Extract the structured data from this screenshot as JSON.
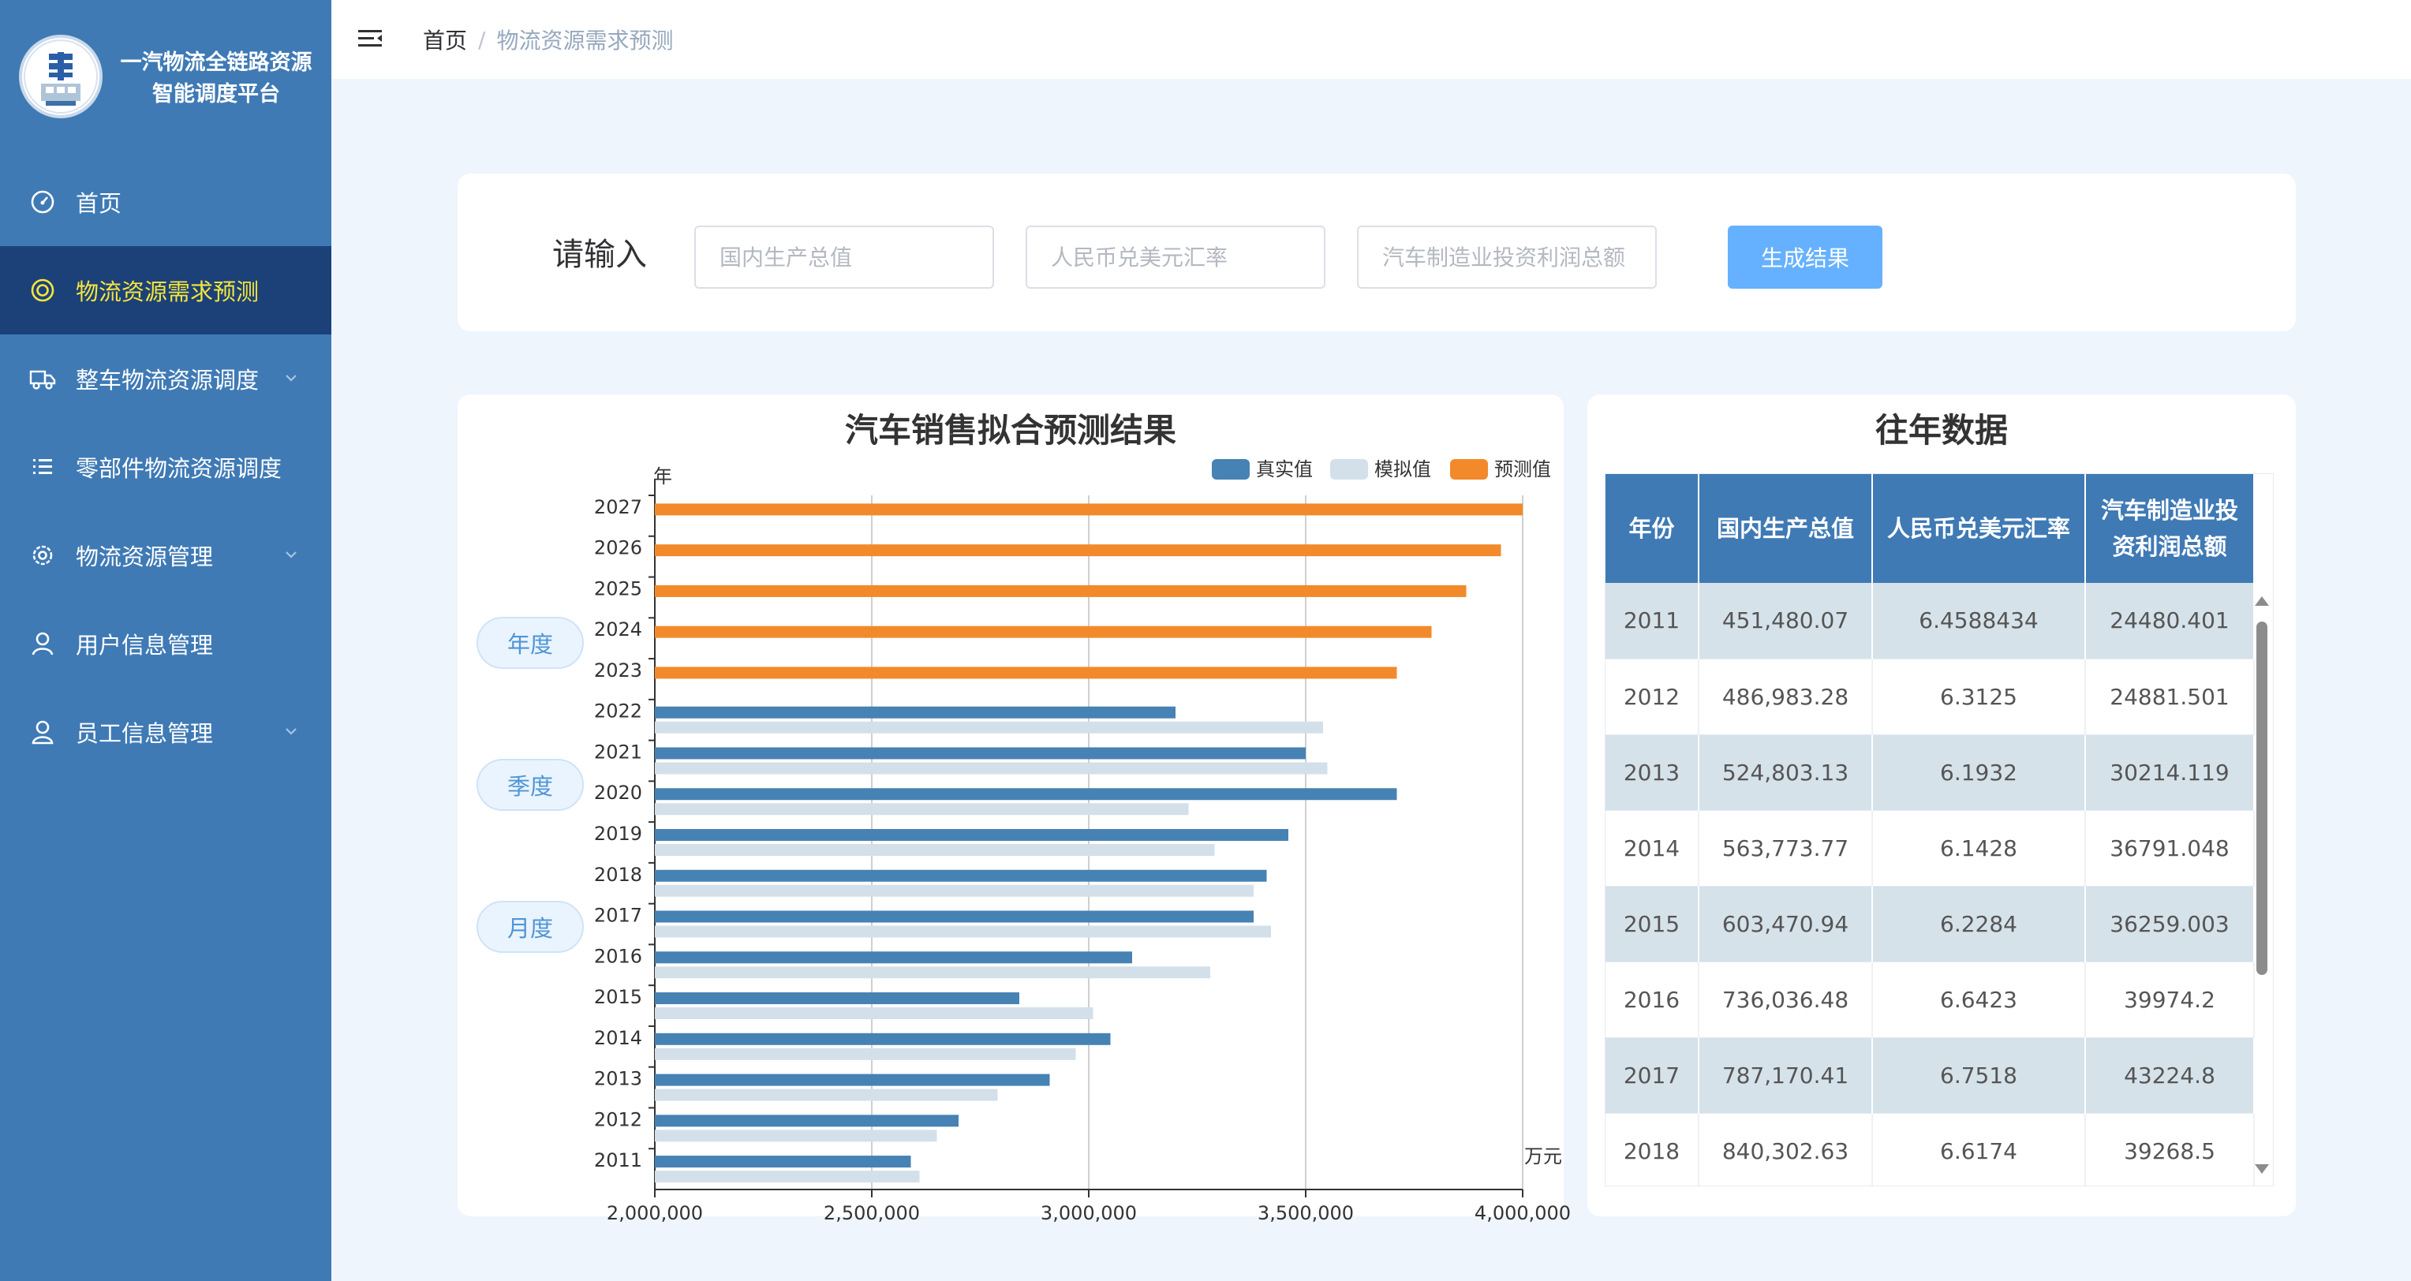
{
  "brand": {
    "title_line1": "一汽物流全链路资源",
    "title_line2": "智能调度平台"
  },
  "sidebar": {
    "items": [
      {
        "label": "首页",
        "icon": "dashboard-icon",
        "active": false,
        "has_children": false
      },
      {
        "label": "物流资源需求预测",
        "icon": "target-icon",
        "active": true,
        "has_children": false
      },
      {
        "label": "整车物流资源调度",
        "icon": "truck-icon",
        "active": false,
        "has_children": true
      },
      {
        "label": "零部件物流资源调度",
        "icon": "list-icon",
        "active": false,
        "has_children": false
      },
      {
        "label": "物流资源管理",
        "icon": "gear-icon",
        "active": false,
        "has_children": true
      },
      {
        "label": "用户信息管理",
        "icon": "user-icon",
        "active": false,
        "has_children": false
      },
      {
        "label": "员工信息管理",
        "icon": "user-icon",
        "active": false,
        "has_children": true
      }
    ]
  },
  "breadcrumb": {
    "home": "首页",
    "separator": "/",
    "current": "物流资源需求预测"
  },
  "input_form": {
    "label": "请输入",
    "fields": [
      {
        "placeholder": "国内生产总值",
        "value": ""
      },
      {
        "placeholder": "人民币兑美元汇率",
        "value": ""
      },
      {
        "placeholder": "汽车制造业投资利润总额",
        "value": ""
      }
    ],
    "submit_label": "生成结果"
  },
  "period_buttons": [
    "年度",
    "季度",
    "月度"
  ],
  "chart_title": "汽车销售拟合预测结果",
  "table_title": "往年数据",
  "colors": {
    "real": "#4682b4",
    "simulated": "#d3e0ea",
    "forecast": "#f28a2b",
    "sidebar": "#3f7ab5",
    "sidebar_active": "#1c4179",
    "accent": "#66b1ff"
  },
  "chart_data": {
    "type": "bar",
    "orientation": "horizontal",
    "title": "汽车销售拟合预测结果",
    "ylabel": "年",
    "xlabel": "万元",
    "categories": [
      "2011",
      "2012",
      "2013",
      "2014",
      "2015",
      "2016",
      "2017",
      "2018",
      "2019",
      "2020",
      "2021",
      "2022",
      "2023",
      "2024",
      "2025",
      "2026",
      "2027"
    ],
    "xlim": [
      2000000,
      4000000
    ],
    "x_ticks": [
      "2,000,000",
      "2,500,000",
      "3,000,000",
      "3,500,000",
      "4,000,000"
    ],
    "legend": [
      "真实值",
      "模拟值",
      "预测值"
    ],
    "legend_position": "top-right",
    "grid": true,
    "series": [
      {
        "name": "真实值",
        "values": [
          2590000,
          2700000,
          2910000,
          3050000,
          2840000,
          3100000,
          3380000,
          3410000,
          3460000,
          3710000,
          3500000,
          3200000,
          null,
          null,
          null,
          null,
          null
        ]
      },
      {
        "name": "模拟值",
        "values": [
          2610000,
          2650000,
          2790000,
          2970000,
          3010000,
          3280000,
          3420000,
          3380000,
          3290000,
          3230000,
          3550000,
          3540000,
          null,
          null,
          null,
          null,
          null
        ]
      },
      {
        "name": "预测值",
        "values": [
          null,
          null,
          null,
          null,
          null,
          null,
          null,
          null,
          null,
          null,
          null,
          null,
          3710000,
          3790000,
          3870000,
          3950000,
          4000000
        ]
      }
    ]
  },
  "history_table": {
    "headers": [
      "年份",
      "国内生产总值",
      "人民币兑美元汇率",
      "汽车制造业投资利润总额"
    ],
    "rows": [
      [
        "2011",
        "451,480.07",
        "6.4588434",
        "24480.401"
      ],
      [
        "2012",
        "486,983.28",
        "6.3125",
        "24881.501"
      ],
      [
        "2013",
        "524,803.13",
        "6.1932",
        "30214.119"
      ],
      [
        "2014",
        "563,773.77",
        "6.1428",
        "36791.048"
      ],
      [
        "2015",
        "603,470.94",
        "6.2284",
        "36259.003"
      ],
      [
        "2016",
        "736,036.48",
        "6.6423",
        "39974.2"
      ],
      [
        "2017",
        "787,170.41",
        "6.7518",
        "43224.8"
      ],
      [
        "2018",
        "840,302.63",
        "6.6174",
        "39268.5"
      ]
    ]
  }
}
